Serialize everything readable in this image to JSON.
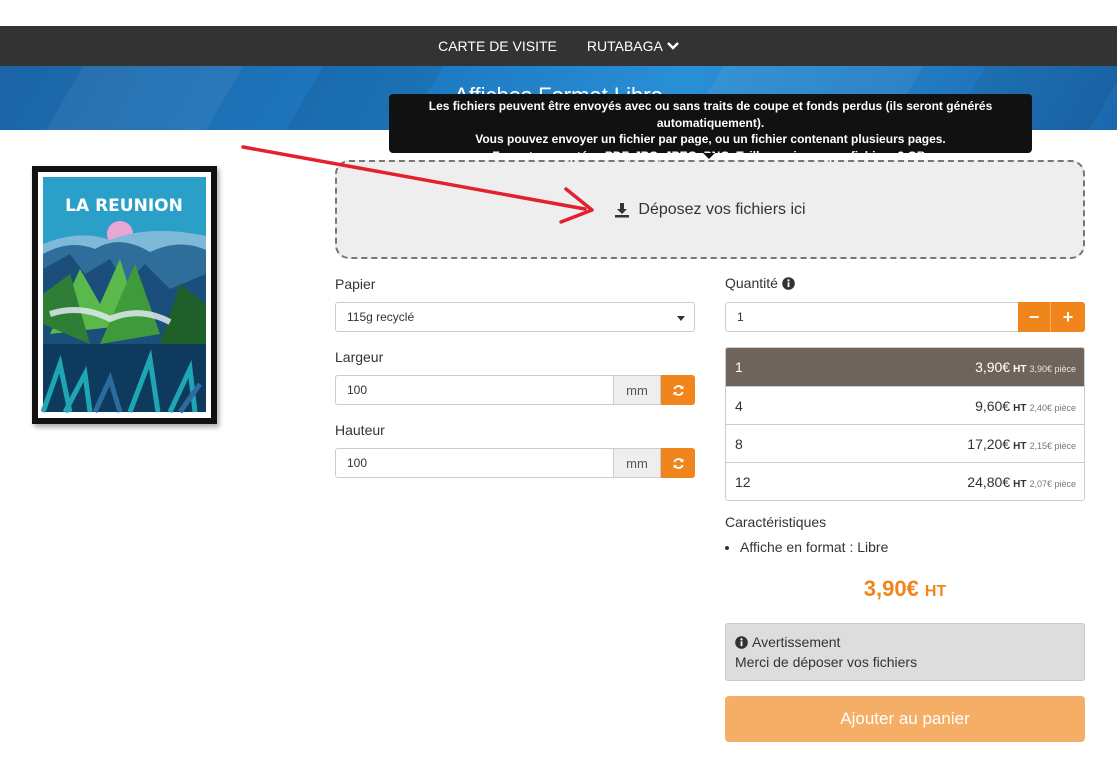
{
  "nav": {
    "items": [
      {
        "label": "CARTE DE VISITE"
      },
      {
        "label": "RUTABAGA"
      }
    ]
  },
  "hero": {
    "title": "Affiches Format Libre"
  },
  "tooltip": {
    "line1": "Les fichiers peuvent être envoyés avec ou sans traits de coupe et fonds perdus (ils seront générés automatiquement).",
    "line2": "Vous pouvez envoyer un fichier par page, ou un fichier contenant plusieurs pages.",
    "line3": "Formats acceptés : PDF, JPG, JPEG, PNG. Taille maximum par fichier : 2 GB."
  },
  "poster": {
    "text": "LA REUNION"
  },
  "dropzone": {
    "label": "Déposez vos fichiers ici"
  },
  "form": {
    "paper_label": "Papier",
    "paper_value": "115g recyclé",
    "width_label": "Largeur",
    "width_value": "100",
    "height_label": "Hauteur",
    "height_value": "100",
    "unit": "mm"
  },
  "quantity": {
    "label": "Quantité",
    "value": "1",
    "minus": "−",
    "plus": "+"
  },
  "price_table": {
    "ht": "HT",
    "rows": [
      {
        "qty": "1",
        "price": "3,90€",
        "unit": "3,90€ pièce",
        "active": true
      },
      {
        "qty": "4",
        "price": "9,60€",
        "unit": "2,40€ pièce",
        "active": false
      },
      {
        "qty": "8",
        "price": "17,20€",
        "unit": "2,15€ pièce",
        "active": false
      },
      {
        "qty": "12",
        "price": "24,80€",
        "unit": "2,07€ pièce",
        "active": false
      }
    ]
  },
  "features": {
    "title": "Caractéristiques",
    "items": [
      "Affiche en format : Libre"
    ]
  },
  "total": {
    "price": "3,90€",
    "ht": "HT"
  },
  "alert": {
    "title": "Avertissement",
    "message": "Merci de déposer vos fichiers"
  },
  "cart": {
    "label": "Ajouter au panier"
  },
  "colors": {
    "accent": "#f0851b",
    "navbar": "#333333",
    "hero": "#1e7cc4",
    "active_row": "#6e645b",
    "arrow": "#e3202e"
  }
}
